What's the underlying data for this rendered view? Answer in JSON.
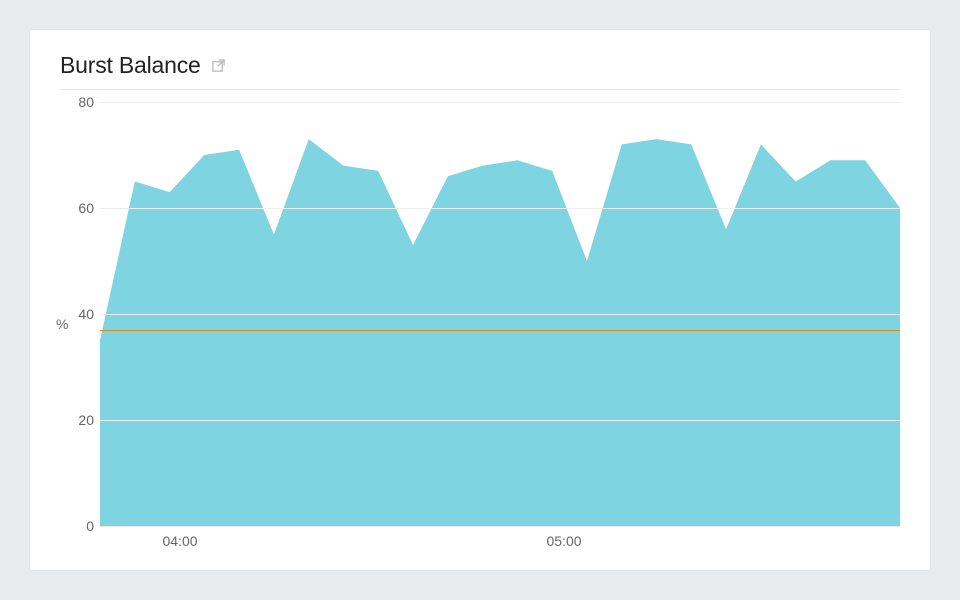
{
  "panel": {
    "title": "Burst Balance",
    "external_link_icon": "external-link-icon"
  },
  "chart_data": {
    "type": "area",
    "title": "Burst Balance",
    "ylabel": "%",
    "xlabel": "",
    "ylim": [
      0,
      80
    ],
    "y_ticks": [
      0,
      20,
      40,
      60,
      80
    ],
    "x_ticks": [
      "04:00",
      "05:00"
    ],
    "x_tick_positions_pct": [
      10,
      58
    ],
    "threshold": 37,
    "series": [
      {
        "name": "Burst Balance",
        "color": "#7ed4e1",
        "values": [
          35,
          65,
          63,
          70,
          71,
          55,
          73,
          68,
          67,
          53,
          66,
          68,
          69,
          67,
          50,
          72,
          73,
          72,
          56,
          72,
          65,
          69,
          69,
          60
        ]
      }
    ]
  }
}
